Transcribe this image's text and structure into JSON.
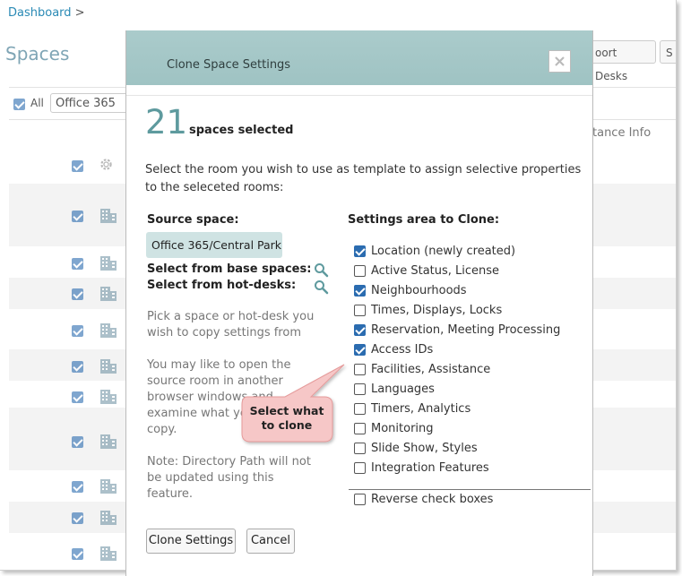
{
  "breadcrumb": {
    "link": "Dashboard",
    "separator": ">"
  },
  "page_title": "Spaces",
  "toolbar": {
    "import_desks_label": "oort Desks",
    "next_label": "S"
  },
  "filter": {
    "all_label": "All",
    "space_select_value": "Office 365"
  },
  "table": {
    "partial_column_header": "tance Info"
  },
  "modal": {
    "title": "Clone Space Settings",
    "count": "21",
    "count_label": "spaces selected",
    "instruction": "Select the room you wish to use as template to assign selective properties to the seleceted rooms:",
    "source_heading": "Source space:",
    "source_value": "Office 365/Central Park",
    "base_spaces_label": "Select from base spaces:",
    "hot_desks_label": "Select from hot-desks:",
    "help_pick": "Pick a space or hot-desk you wish to copy settings from",
    "help_open": "You may like to open the source room in another browser windows and examine what you want to copy.",
    "help_note": "Note: Directory Path will not be updated using this feature.",
    "settings_heading": "Settings area to Clone:",
    "settings": [
      {
        "label": "Location (newly created)",
        "checked": true
      },
      {
        "label": "Active Status, License",
        "checked": false
      },
      {
        "label": "Neighbourhoods",
        "checked": true
      },
      {
        "label": "Times, Displays, Locks",
        "checked": false
      },
      {
        "label": "Reservation, Meeting Processing",
        "checked": true
      },
      {
        "label": "Access IDs",
        "checked": true
      },
      {
        "label": "Facilities, Assistance",
        "checked": false
      },
      {
        "label": "Languages",
        "checked": false
      },
      {
        "label": "Timers, Analytics",
        "checked": false
      },
      {
        "label": "Monitoring",
        "checked": false
      },
      {
        "label": "Slide Show, Styles",
        "checked": false
      },
      {
        "label": "Integration Features",
        "checked": false
      }
    ],
    "reverse_label": "Reverse check boxes",
    "clone_button": "Clone Settings",
    "cancel_button": "Cancel"
  },
  "callout": {
    "line1": "Select what",
    "line2": "to clone"
  },
  "colors": {
    "accent": "#5e9a9e",
    "header": "#a3c7c7",
    "checkbox": "#2b6cb0",
    "callout": "#f6c7c7"
  }
}
